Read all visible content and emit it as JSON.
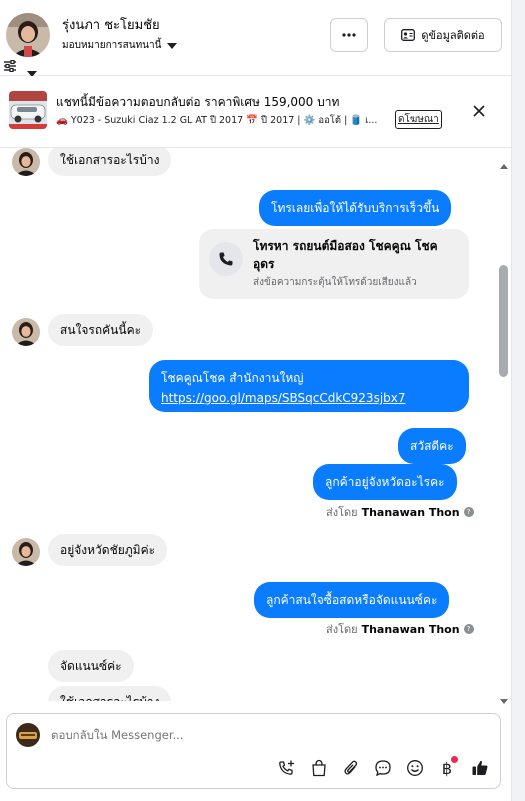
{
  "header": {
    "user_name": "รุ่งนภา ชะโยมชัย",
    "assign_label": "มอบหมายการสนทนานี้",
    "more_label": "···",
    "contact_label": "ดูข้อมูลติดต่อ"
  },
  "ad": {
    "title": "แชทนี้มีข้อความตอบกลับต่อ ราคาพิเศษ 159,000 บาท",
    "details": "🚗 Y023 - Suzuki Ciaz 1.2 GL AT ปี 2017 📅 ปี 2017 | ⚙️ ออโต้ | 🛢️ เ...",
    "link_label": "ดโฆษณา"
  },
  "messages": {
    "m1": "ใช้เอกสารอะไรบ้าง",
    "m2": "โทรเลยเพื่อให้ได้รับบริการเร็วขึ้น",
    "call_title": "โทรหา รถยนต์มือสอง โชคคูณ โชค อุดร",
    "call_sub": "ส่งข้อความกระตุ้นให้โทรด้วยเสียงแล้ว",
    "m3": "สนใจรถคันนี้คะ",
    "m4_line1": "โชคคูณโชค สำนักงานใหญ่",
    "m4_link": "https://goo.gl/maps/SBSqcCdkC923sjbx7",
    "m5": "สวัสดีคะ",
    "m6": "ลูกค้าอยู่จังหวัดอะไรคะ",
    "sent_by_prefix": "ส่งโดย",
    "sent_by_name": "Thanawan Thon",
    "m7": "อยู่จังหวัดชัยภูมิค่ะ",
    "m8": "ลูกค้าสนใจซื้อสดหรือจัดแนนซ์คะ",
    "m9": "จัดแนนซ์ค่ะ",
    "m10": "ใช้เอกสารอะไรบ้าง"
  },
  "composer": {
    "placeholder": "ตอบกลับใน Messenger..."
  },
  "icons": {
    "more": "ellipsis-icon",
    "contact": "contact-card-icon",
    "close": "close-icon",
    "phone": "phone-icon",
    "settings": "sliders-icon",
    "tools": [
      "add-call-icon",
      "shopping-bag-icon",
      "paperclip-icon",
      "chat-bubble-icon",
      "emoji-icon",
      "baht-icon",
      "thumbs-up-icon"
    ]
  },
  "colors": {
    "outgoing_bubble": "#0a7cff",
    "incoming_bubble": "#f0f0f0",
    "notification": "#f02849"
  }
}
